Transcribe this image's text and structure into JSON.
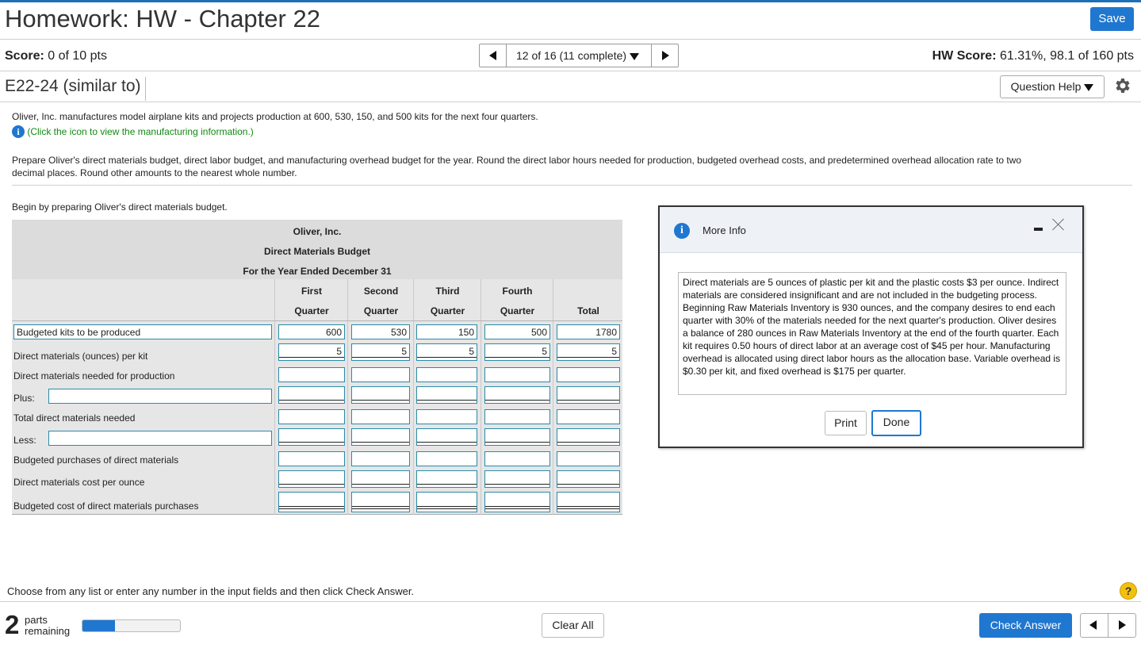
{
  "header": {
    "title": "Homework: HW - Chapter 22",
    "save_label": "Save"
  },
  "status": {
    "score_label": "Score:",
    "score_value": "0 of 10 pts",
    "pager_label": "12 of 16 (11 complete)",
    "hw_score_label": "HW Score:",
    "hw_score_value": "61.31%, 98.1 of 160 pts"
  },
  "question": {
    "id": "E22-24 (similar to)",
    "help_label": "Question Help",
    "intro": "Oliver, Inc. manufactures model airplane kits and projects production at 600, 530, 150, and 500 kits for the next four quarters.",
    "info_link": "(Click the icon to view the manufacturing information.)",
    "instructions_line1": "Prepare Oliver's direct materials budget, direct labor budget, and manufacturing overhead budget for the year. Round the direct labor hours needed for production, budgeted overhead costs, and predetermined overhead allocation rate to two",
    "instructions_line2": "decimal places. Round other amounts to the nearest whole number.",
    "begin": "Begin by preparing Oliver's direct materials budget."
  },
  "budget": {
    "company": "Oliver, Inc.",
    "title": "Direct Materials Budget",
    "period": "For the Year Ended December 31",
    "col_top": [
      "First",
      "Second",
      "Third",
      "Fourth",
      ""
    ],
    "col_bottom": [
      "Quarter",
      "Quarter",
      "Quarter",
      "Quarter",
      "Total"
    ],
    "rows": [
      {
        "label": "Budgeted kits to be produced",
        "values": [
          "600",
          "530",
          "150",
          "500",
          "1780"
        ]
      },
      {
        "label": "Direct materials (ounces) per kit",
        "values": [
          "5",
          "5",
          "5",
          "5",
          "5"
        ]
      },
      {
        "label": "Direct materials needed for production",
        "values": [
          "",
          "",
          "",
          "",
          ""
        ]
      },
      {
        "label": "Plus:",
        "values": [
          "",
          "",
          "",
          "",
          ""
        ]
      },
      {
        "label": "Total direct materials needed",
        "values": [
          "",
          "",
          "",
          "",
          ""
        ]
      },
      {
        "label": "Less:",
        "values": [
          "",
          "",
          "",
          "",
          ""
        ]
      },
      {
        "label": "Budgeted purchases of direct materials",
        "values": [
          "",
          "",
          "",
          "",
          ""
        ]
      },
      {
        "label": "Direct materials cost per ounce",
        "values": [
          "",
          "",
          "",
          "",
          ""
        ]
      },
      {
        "label": "Budgeted cost of direct materials purchases",
        "values": [
          "",
          "",
          "",
          "",
          ""
        ]
      }
    ]
  },
  "modal": {
    "title": "More Info",
    "body": "Direct materials are 5 ounces of plastic per kit and the plastic costs $3 per ounce. Indirect materials are considered insignificant and are not included in the budgeting process. Beginning Raw Materials Inventory is 930 ounces, and the company desires to end each quarter with 30% of the materials needed for the next quarter's production. Oliver desires a balance of 280 ounces in Raw Materials Inventory at the end of the fourth quarter. Each kit requires 0.50 hours of direct labor at an average cost of $45 per hour. Manufacturing overhead is allocated using direct labor hours as the allocation base. Variable overhead is $0.30 per kit, and fixed overhead is $175 per quarter.",
    "print_label": "Print",
    "done_label": "Done"
  },
  "footer": {
    "instruction": "Choose from any list or enter any number in the input fields and then click Check Answer.",
    "parts_count": "2",
    "parts_label_1": "parts",
    "parts_label_2": "remaining",
    "progress_fraction": 0.33,
    "clear_label": "Clear All",
    "check_label": "Check Answer",
    "help_icon": "?"
  },
  "colors": {
    "accent": "#1f77d0",
    "link_green": "#118a11",
    "input_border": "#2a8ba8"
  }
}
